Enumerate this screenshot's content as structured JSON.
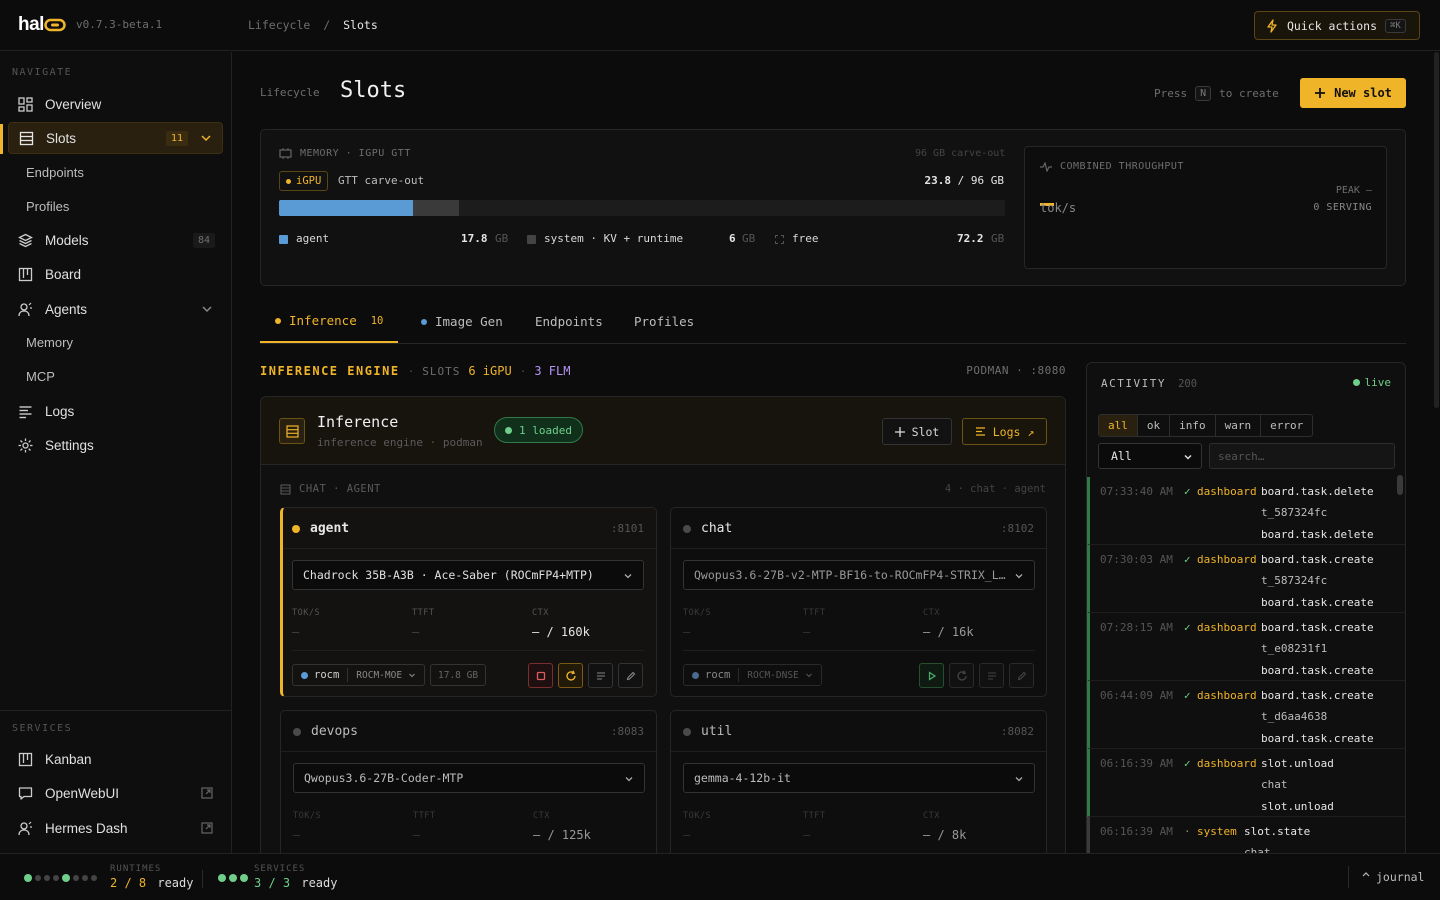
{
  "app": {
    "logo": "hal",
    "version": "v0.7.3-beta.1"
  },
  "breadcrumb": {
    "parent": "Lifecycle",
    "sep": "/",
    "current": "Slots"
  },
  "quick_actions": {
    "label": "Quick actions",
    "shortcut": "⌘K"
  },
  "sidebar": {
    "navigate_label": "NAVIGATE",
    "items": [
      {
        "label": "Overview"
      },
      {
        "label": "Slots",
        "count": "11"
      },
      {
        "label": "Endpoints"
      },
      {
        "label": "Profiles"
      },
      {
        "label": "Models",
        "count": "84"
      },
      {
        "label": "Board"
      },
      {
        "label": "Agents"
      },
      {
        "label": "Memory"
      },
      {
        "label": "MCP"
      },
      {
        "label": "Logs"
      },
      {
        "label": "Settings"
      }
    ],
    "services_label": "SERVICES",
    "services": [
      {
        "label": "Kanban"
      },
      {
        "label": "OpenWebUI"
      },
      {
        "label": "Hermes Dash"
      }
    ]
  },
  "footer": {
    "runtimes_label": "RUNTIMES",
    "runtimes_value": "2 / 8",
    "runtimes_status": "ready",
    "services_label": "SERVICES",
    "services_value": "3 / 3",
    "services_status": "ready",
    "journal": "journal"
  },
  "page": {
    "sub": "Lifecycle",
    "title": "Slots",
    "press": "Press",
    "press_key": "N",
    "press_suffix": "to create",
    "new_slot": "New slot"
  },
  "memory": {
    "title": "MEMORY · IGPU GTT",
    "carveout": "96 GB carve-out",
    "badge": "iGPU",
    "badge_desc": "GTT carve-out",
    "used": "23.8",
    "total": "/ 96 GB",
    "agent_fraction": 0.185,
    "system_fraction": 0.0625,
    "legend": [
      {
        "label": "agent",
        "value": "17.8",
        "unit": "GB"
      },
      {
        "label": "system · KV + runtime",
        "value": "6",
        "unit": "GB"
      },
      {
        "label": "free",
        "value": "72.2",
        "unit": "GB"
      }
    ]
  },
  "throughput": {
    "title": "COMBINED THROUGHPUT",
    "unit": "tok/s",
    "peak": "PEAK —",
    "serving": "0 SERVING"
  },
  "tabs": [
    {
      "label": "Inference",
      "count": "10"
    },
    {
      "label": "Image Gen"
    },
    {
      "label": "Endpoints"
    },
    {
      "label": "Profiles"
    }
  ],
  "engine_header": {
    "title": "INFERENCE ENGINE",
    "slots_label": "SLOTS",
    "igpu": "6 iGPU",
    "flm": "3 FLM",
    "podman": "PODMAN · :8080"
  },
  "engine": {
    "name": "Inference",
    "desc": "inference engine · podman",
    "loaded": "1 loaded",
    "slot_btn": "Slot",
    "logs_btn": "Logs ↗",
    "group_label": "CHAT · AGENT",
    "group_meta": "4 · chat · agent"
  },
  "slots": [
    {
      "name": "agent",
      "port": ":8101",
      "model": "Chadrock 35B-A3B · Ace-Saber (ROCmFP4+MTP)",
      "tok": "—",
      "ttft": "—",
      "ctx": "— / 160k",
      "backend": "rocm",
      "profile": "ROCM-MOE",
      "mem": "17.8 GB"
    },
    {
      "name": "chat",
      "port": ":8102",
      "model": "Qwopus3.6-27B-v2-MTP-BF16-to-ROCmFP4-STRIX_L…",
      "tok": "—",
      "ttft": "—",
      "ctx": "— / 16k",
      "backend": "rocm",
      "profile": "ROCM-DNSE"
    },
    {
      "name": "devops",
      "port": ":8083",
      "model": "Qwopus3.6-27B-Coder-MTP",
      "tok": "—",
      "ttft": "—",
      "ctx": "— / 125k"
    },
    {
      "name": "util",
      "port": ":8082",
      "model": "gemma-4-12b-it",
      "tok": "—",
      "ttft": "—",
      "ctx": "— / 8k"
    }
  ],
  "metric_labels": {
    "tok": "TOK/S",
    "ttft": "TTFT",
    "ctx": "CTX"
  },
  "activity": {
    "title": "ACTIVITY",
    "count": "200",
    "live": "live",
    "filters": [
      "all",
      "ok",
      "info",
      "warn",
      "error"
    ],
    "select": "All",
    "search_placeholder": "search…",
    "entries": [
      {
        "time": "07:33:40 AM",
        "mark": "✓",
        "source": "dashboard",
        "event": "board.task.delete",
        "detail": "t_587324fc",
        "event2": "board.task.delete"
      },
      {
        "time": "07:30:03 AM",
        "mark": "✓",
        "source": "dashboard",
        "event": "board.task.create",
        "detail": "t_587324fc",
        "event2": "board.task.create"
      },
      {
        "time": "07:28:15 AM",
        "mark": "✓",
        "source": "dashboard",
        "event": "board.task.create",
        "detail": "t_e08231f1",
        "event2": "board.task.create"
      },
      {
        "time": "06:44:09 AM",
        "mark": "✓",
        "source": "dashboard",
        "event": "board.task.create",
        "detail": "t_d6aa4638",
        "event2": "board.task.create"
      },
      {
        "time": "06:16:39 AM",
        "mark": "✓",
        "source": "dashboard",
        "event": "slot.unload",
        "detail": "chat",
        "event2": "slot.unload"
      },
      {
        "time": "06:16:39 AM",
        "mark": "·",
        "source": "system",
        "event": "slot.state",
        "detail": "chat",
        "event2": ""
      }
    ]
  }
}
